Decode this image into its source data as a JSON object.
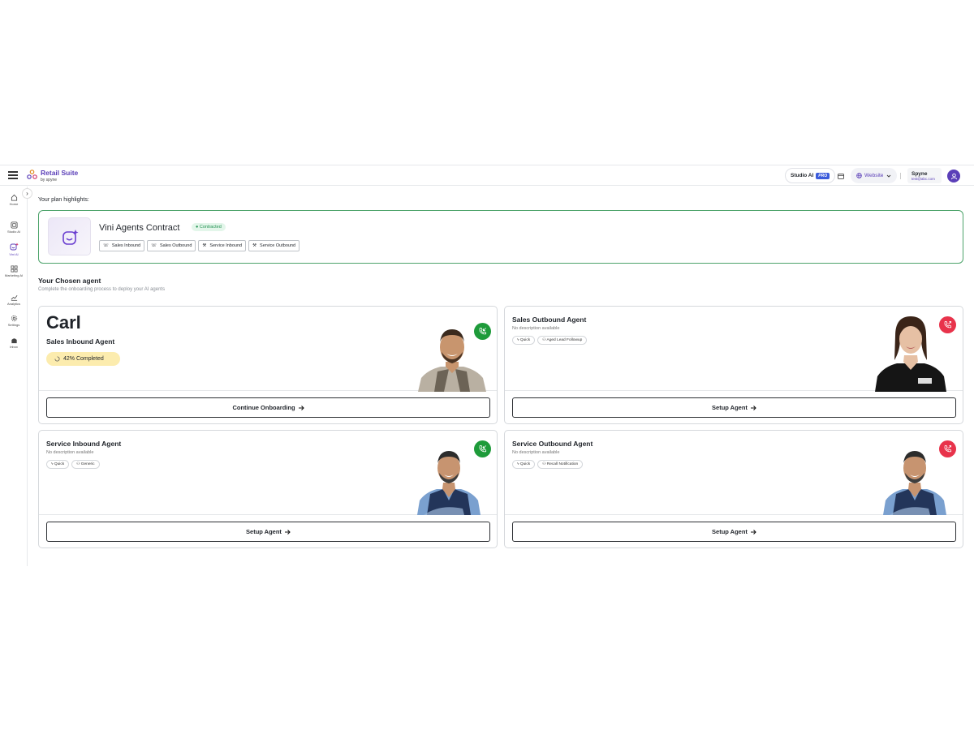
{
  "header": {
    "app_name": "Retail Suite",
    "app_sub": "by spyne",
    "studio_label": "Studio AI",
    "pro_label": "PRO",
    "website_label": "Website",
    "user_name": "Spyne",
    "user_email": "test@abc.com"
  },
  "sidebar": {
    "items": [
      {
        "label": "Home",
        "icon": "home-icon"
      },
      {
        "label": "Studio AI",
        "icon": "studio-icon"
      },
      {
        "label": "Vini AI",
        "icon": "vini-icon",
        "active": true
      },
      {
        "label": "Marketing AI",
        "icon": "grid-icon"
      },
      {
        "label": "Analytics",
        "icon": "chart-icon"
      },
      {
        "label": "Settings",
        "icon": "gear-icon"
      },
      {
        "label": "Inbox",
        "icon": "inbox-icon"
      }
    ]
  },
  "plan": {
    "heading": "Your plan highlights:",
    "name": "Vini Agents Contract",
    "status": "Contracted",
    "chips": [
      "Sales Inbound",
      "Sales Outbound",
      "Service Inbound",
      "Service Outbound"
    ]
  },
  "chosen": {
    "title": "Your Chosen agent",
    "subtitle": "Complete the onboarding process to deploy your AI agents"
  },
  "agents": [
    {
      "big_name": "Carl",
      "name": "Sales Inbound Agent",
      "progress_text": "42% Completed",
      "progress": 0.42,
      "button": "Continue Onboarding",
      "call": "inbound"
    },
    {
      "name": "Sales Outbound Agent",
      "desc": "No description available",
      "tags": [
        "Quick",
        "Aged Lead Followup"
      ],
      "button": "Setup Agent",
      "call": "outbound"
    },
    {
      "name": "Service Inbound Agent",
      "desc": "No description available",
      "tags": [
        "Quick",
        "Generic"
      ],
      "button": "Setup Agent",
      "call": "inbound"
    },
    {
      "name": "Service Outbound Agent",
      "desc": "No description available",
      "tags": [
        "Quick",
        "Recall Notification"
      ],
      "button": "Setup Agent",
      "call": "outbound"
    }
  ],
  "colors": {
    "accent": "#5b3fb8",
    "success": "#1e9b3a",
    "danger": "#e8334b",
    "plan_border": "#4ca36a"
  }
}
